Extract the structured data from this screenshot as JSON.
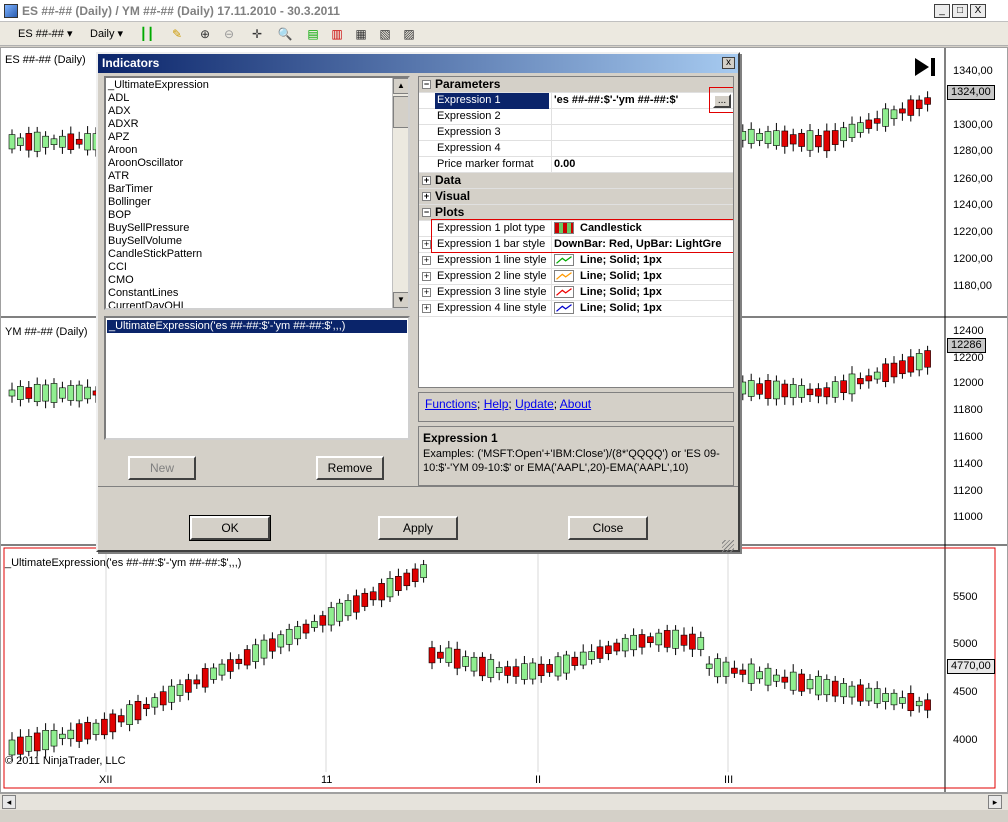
{
  "window": {
    "title": "ES ##-## (Daily) / YM ##-## (Daily)  17.11.2010 - 30.3.2011",
    "minimize_label": "_",
    "maximize_label": "□",
    "close_label": "X"
  },
  "toolbar": {
    "instrument": "ES ##-##",
    "interval": "Daily"
  },
  "panels": {
    "es_label": "ES ##-## (Daily)",
    "ym_label": "YM ##-## (Daily)",
    "ue_label": "_UltimateExpression('es ##-##:$'-'ym ##-##:$',,,)",
    "es_axis": [
      "1340,00",
      "1320,00",
      "1300,00",
      "1280,00",
      "1260,00",
      "1240,00",
      "1220,00",
      "1200,00",
      "1180,00"
    ],
    "es_marker": "1324,00",
    "ym_axis": [
      "12400",
      "12200",
      "12000",
      "11800",
      "11600",
      "11400",
      "11200",
      "11000"
    ],
    "ym_marker": "12286",
    "ue_axis": [
      "5500",
      "5000",
      "4500",
      "4000"
    ],
    "ue_marker": "4770,00",
    "x_axis": [
      "XII",
      "11",
      "II",
      "III"
    ],
    "copyright": "© 2011 NinjaTrader, LLC"
  },
  "dialog": {
    "title": "Indicators",
    "close_label": "x",
    "indicator_list": [
      "_UltimateExpression",
      "ADL",
      "ADX",
      "ADXR",
      "APZ",
      "Aroon",
      "AroonOscillator",
      "ATR",
      "BarTimer",
      "Bollinger",
      "BOP",
      "BuySellPressure",
      "BuySellVolume",
      "CandleStickPattern",
      "CCI",
      "CMO",
      "ConstantLines",
      "CurrentDayOHL"
    ],
    "applied": [
      "_UltimateExpression('es ##-##:$'-'ym ##-##:$',,,)"
    ],
    "new_button": "New",
    "remove_button": "Remove",
    "ok_button": "OK",
    "apply_button": "Apply",
    "close_button": "Close",
    "properties": {
      "parameters_label": "Parameters",
      "expr1_name": "Expression 1",
      "expr1_value": "'es ##-##:$'-'ym ##-##:$'",
      "expr2_name": "Expression 2",
      "expr3_name": "Expression 3",
      "expr4_name": "Expression 4",
      "price_marker_name": "Price marker format",
      "price_marker_value": "0.00",
      "data_label": "Data",
      "visual_label": "Visual",
      "plots_label": "Plots",
      "plot_type_name": "Expression 1 plot type",
      "plot_type_value": "Candlestick",
      "bar_style_name": "Expression 1 bar style",
      "bar_style_value": "DownBar: Red, UpBar: LightGre",
      "line1_name": "Expression 1 line style",
      "line1_value": "Line; Solid; 1px",
      "line2_name": "Expression 2 line style",
      "line2_value": "Line; Solid; 1px",
      "line3_name": "Expression 3 line style",
      "line3_value": "Line; Solid; 1px",
      "line4_name": "Expression 4 line style",
      "line4_value": "Line; Solid; 1px",
      "ellipsis": "..."
    },
    "links": {
      "functions": "Functions",
      "help": "Help",
      "update": "Update",
      "about": "About"
    },
    "help_title": "Expression 1",
    "help_text": "Examples: ('MSFT:Open'+'IBM:Close')/(8*'QQQQ') or 'ES 09-10:$'-'YM 09-10:$' or EMA('AAPL',20)-EMA('AAPL',10)"
  },
  "colors": {
    "up_bar": "#90ee90",
    "down_bar": "#e00000",
    "highlight": "#e00000",
    "selection": "#0a246a"
  }
}
